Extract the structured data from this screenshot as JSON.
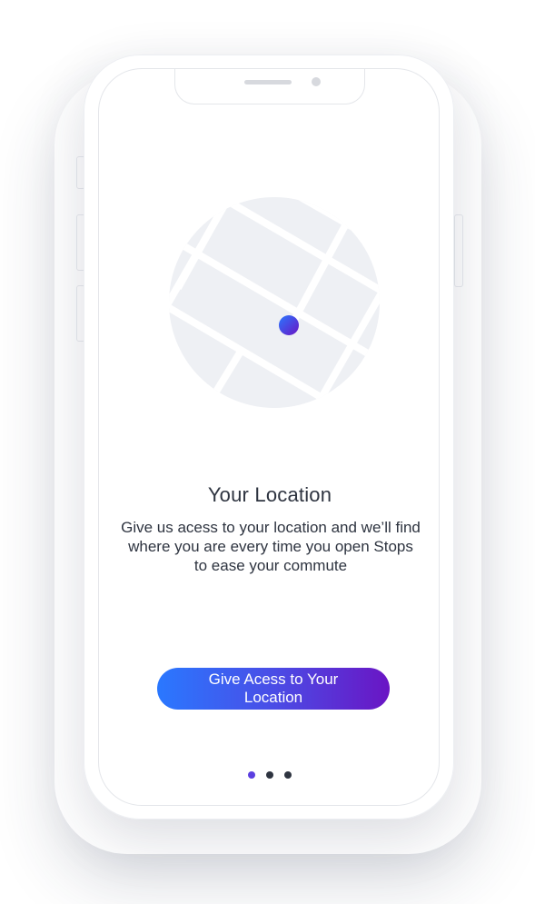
{
  "onboarding": {
    "title": "Your Location",
    "description": "Give us acess to your location and we’ll find where you are every  time you open Stops to ease your commute",
    "cta_label": "Give Acess to Your Location",
    "page_indicator": {
      "current": 1,
      "total": 3
    }
  },
  "colors": {
    "accent_start": "#2a78ff",
    "accent_end": "#6a15c4",
    "text": "#2e3440",
    "map_fill": "#eef0f4"
  },
  "icons": {
    "illustration": "map-location-illustration",
    "pin": "location-dot-icon"
  }
}
